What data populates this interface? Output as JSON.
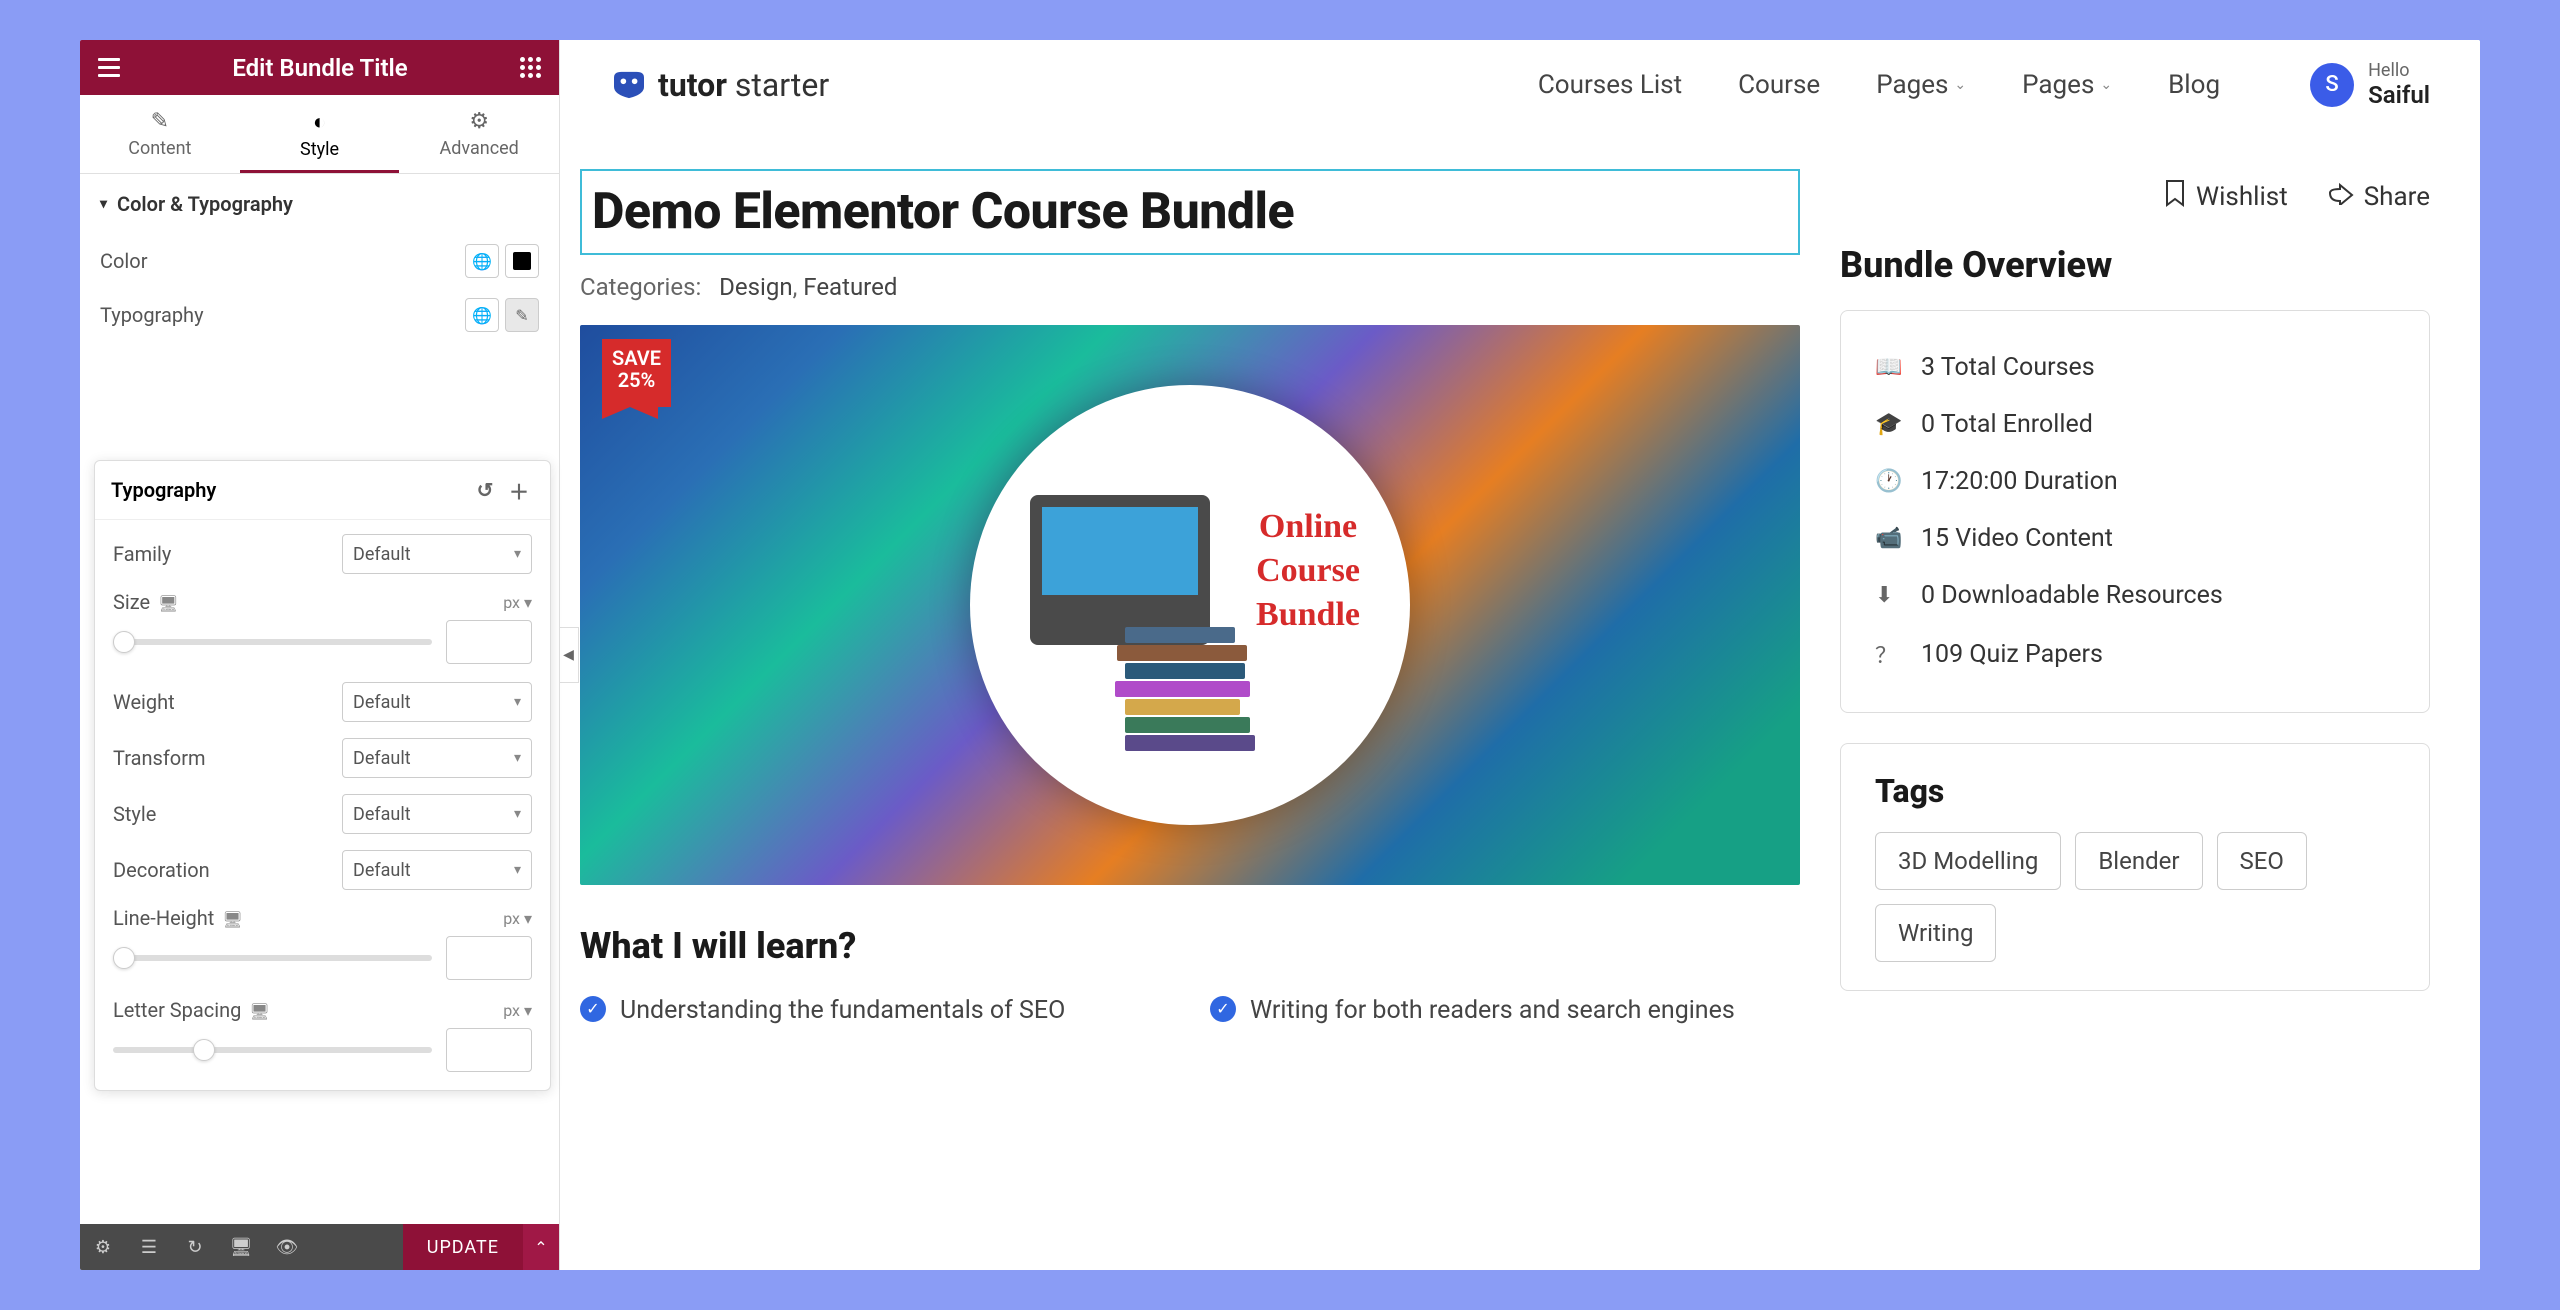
{
  "panel": {
    "title": "Edit Bundle Title",
    "tabs": {
      "content": "Content",
      "style": "Style",
      "advanced": "Advanced"
    },
    "section": "Color & Typography",
    "rows": {
      "color": "Color",
      "typography": "Typography"
    },
    "typo": {
      "heading": "Typography",
      "family_label": "Family",
      "family_value": "Default",
      "size_label": "Size",
      "size_unit": "px",
      "weight_label": "Weight",
      "weight_value": "Default",
      "transform_label": "Transform",
      "transform_value": "Default",
      "style_label": "Style",
      "style_value": "Default",
      "decoration_label": "Decoration",
      "decoration_value": "Default",
      "lineheight_label": "Line-Height",
      "lineheight_unit": "px",
      "letterspacing_label": "Letter Spacing",
      "letterspacing_unit": "px"
    },
    "update": "UPDATE"
  },
  "site": {
    "logo_bold": "tutor",
    "logo_light": " starter",
    "nav": [
      "Courses List",
      "Course",
      "Pages",
      "Pages",
      "Blog"
    ],
    "hello": "Hello",
    "username": "Saiful",
    "initial": "S"
  },
  "bundle": {
    "title": "Demo Elementor Course Bundle",
    "cat_label": "Categories:",
    "cat1": "Design",
    "cat2": "Featured",
    "badge_line1": "SAVE",
    "badge_line2": "25%",
    "hero_line1": "Online",
    "hero_line2": "Course",
    "hero_line3": "Bundle",
    "learn_title": "What I will learn?",
    "learn_items": [
      "Understanding the fundamentals of SEO",
      "Writing for both readers and search engines"
    ]
  },
  "actions": {
    "wishlist": "Wishlist",
    "share": "Share"
  },
  "overview": {
    "title": "Bundle Overview",
    "items": [
      "3 Total Courses",
      "0 Total Enrolled",
      "17:20:00 Duration",
      "15 Video Content",
      "0 Downloadable Resources",
      "109 Quiz Papers"
    ]
  },
  "tags": {
    "title": "Tags",
    "list": [
      "3D Modelling",
      "Blender",
      "SEO",
      "Writing"
    ]
  }
}
